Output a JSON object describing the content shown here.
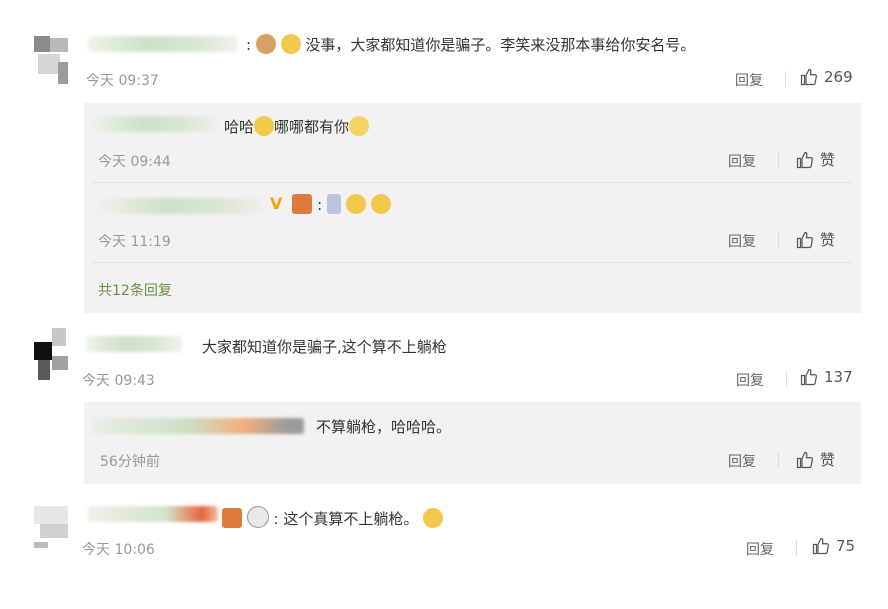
{
  "comments": [
    {
      "text": "没事，大家都知道你是骗子。李笑来没那本事给你安名号。",
      "time": "今天 09:37",
      "reply_label": "回复",
      "likes": "269"
    },
    {
      "text": "大家都知道你是骗子,这个算不上躺枪",
      "time": "今天 09:43",
      "reply_label": "回复",
      "likes": "137"
    },
    {
      "text": "这个真算不上躺枪。",
      "time": "今天 10:06",
      "reply_label": "回复",
      "likes": "75"
    }
  ],
  "replies_1": [
    {
      "text_prefix": "哈哈",
      "text_suffix": "哪哪都有你",
      "time": "今天 09:44",
      "reply_label": "回复",
      "like_label": "赞"
    },
    {
      "badge": "V",
      "time": "今天 11:19",
      "reply_label": "回复",
      "like_label": "赞"
    }
  ],
  "more_replies": "共12条回复",
  "replies_2": [
    {
      "text": "不算躺枪，哈哈哈。",
      "time": "56分钟前",
      "reply_label": "回复",
      "like_label": "赞"
    }
  ],
  "colors": {
    "like_icon": "#555555",
    "more_link": "#6a8f3f",
    "vip": "#f4a300"
  },
  "icons": [
    "thumbs-up-icon",
    "emoji-icon"
  ]
}
